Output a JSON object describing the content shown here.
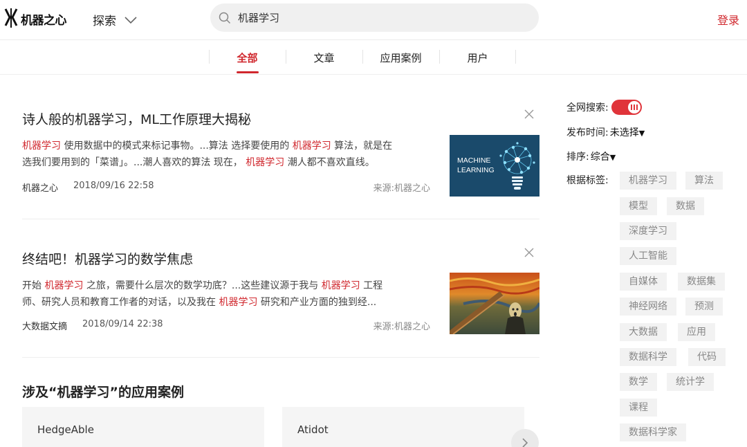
{
  "header": {
    "logo_text": "机器之心",
    "explore_label": "探索",
    "search_value": "机器学习",
    "login_label": "登录"
  },
  "tabs": [
    {
      "label": "全部",
      "active": true
    },
    {
      "label": "文章",
      "active": false
    },
    {
      "label": "应用案例",
      "active": false
    },
    {
      "label": "用户",
      "active": false
    }
  ],
  "articles": [
    {
      "title": "诗人般的机器学习，ML工作原理大揭秘",
      "summary_line1": [
        {
          "text": "机器学习",
          "hl": true
        },
        {
          "text": " 使用数据中的模式来标记事物。...算法 选择要使用的 ",
          "hl": false
        },
        {
          "text": "机器学习",
          "hl": true
        },
        {
          "text": " 算法，就是在",
          "hl": false
        }
      ],
      "summary_line2": [
        {
          "text": "选我们要用到的「菜谱」。...潮人喜欢的算法 现在， ",
          "hl": false
        },
        {
          "text": "机器学习",
          "hl": true
        },
        {
          "text": " 潮人都不喜欢直线。",
          "hl": false
        }
      ],
      "author": "机器之心",
      "date": "2018/09/16 22:58",
      "source": "来源:机器之心",
      "thumb_text_1": "MACHINE",
      "thumb_text_2": "LEARNING"
    },
    {
      "title": "终结吧！机器学习的数学焦虑",
      "summary_line1": [
        {
          "text": "开始 ",
          "hl": false
        },
        {
          "text": "机器学习",
          "hl": true
        },
        {
          "text": " 之旅，需要什么层次的数学功底？...这些建议源于我与 ",
          "hl": false
        },
        {
          "text": "机器学习",
          "hl": true
        },
        {
          "text": " 工程",
          "hl": false
        }
      ],
      "summary_line2": [
        {
          "text": "师、研究人员和教育工作者的对话，以及我在 ",
          "hl": false
        },
        {
          "text": "机器学习",
          "hl": true
        },
        {
          "text": " 研究和产业方面的独到经...",
          "hl": false
        }
      ],
      "author": "大数据文摘",
      "date": "2018/09/14 22:38",
      "source": "来源:机器之心"
    }
  ],
  "cases_section": {
    "title": "涉及“机器学习”的应用案例",
    "cards": [
      "HedgeAble",
      "Atidot"
    ]
  },
  "sidebar": {
    "search_all_label": "全网搜索:",
    "search_all_on": true,
    "publish_time_label": "发布时间:",
    "publish_time_value": "未选择",
    "sort_label": "排序:",
    "sort_value": "综合",
    "tags_label": "根据标签:",
    "tags": [
      "机器学习",
      "算法",
      "模型",
      "数据",
      "深度学习",
      "人工智能",
      "自媒体",
      "数据集",
      "神经网络",
      "预测",
      "大数据",
      "应用",
      "数据科学",
      "代码",
      "数学",
      "统计学",
      "课程",
      "数据科学家"
    ]
  },
  "colors": {
    "accent": "#d0272d",
    "tag_bg": "#f2f2f2",
    "thumb1_bg": "#1a4a6b"
  }
}
